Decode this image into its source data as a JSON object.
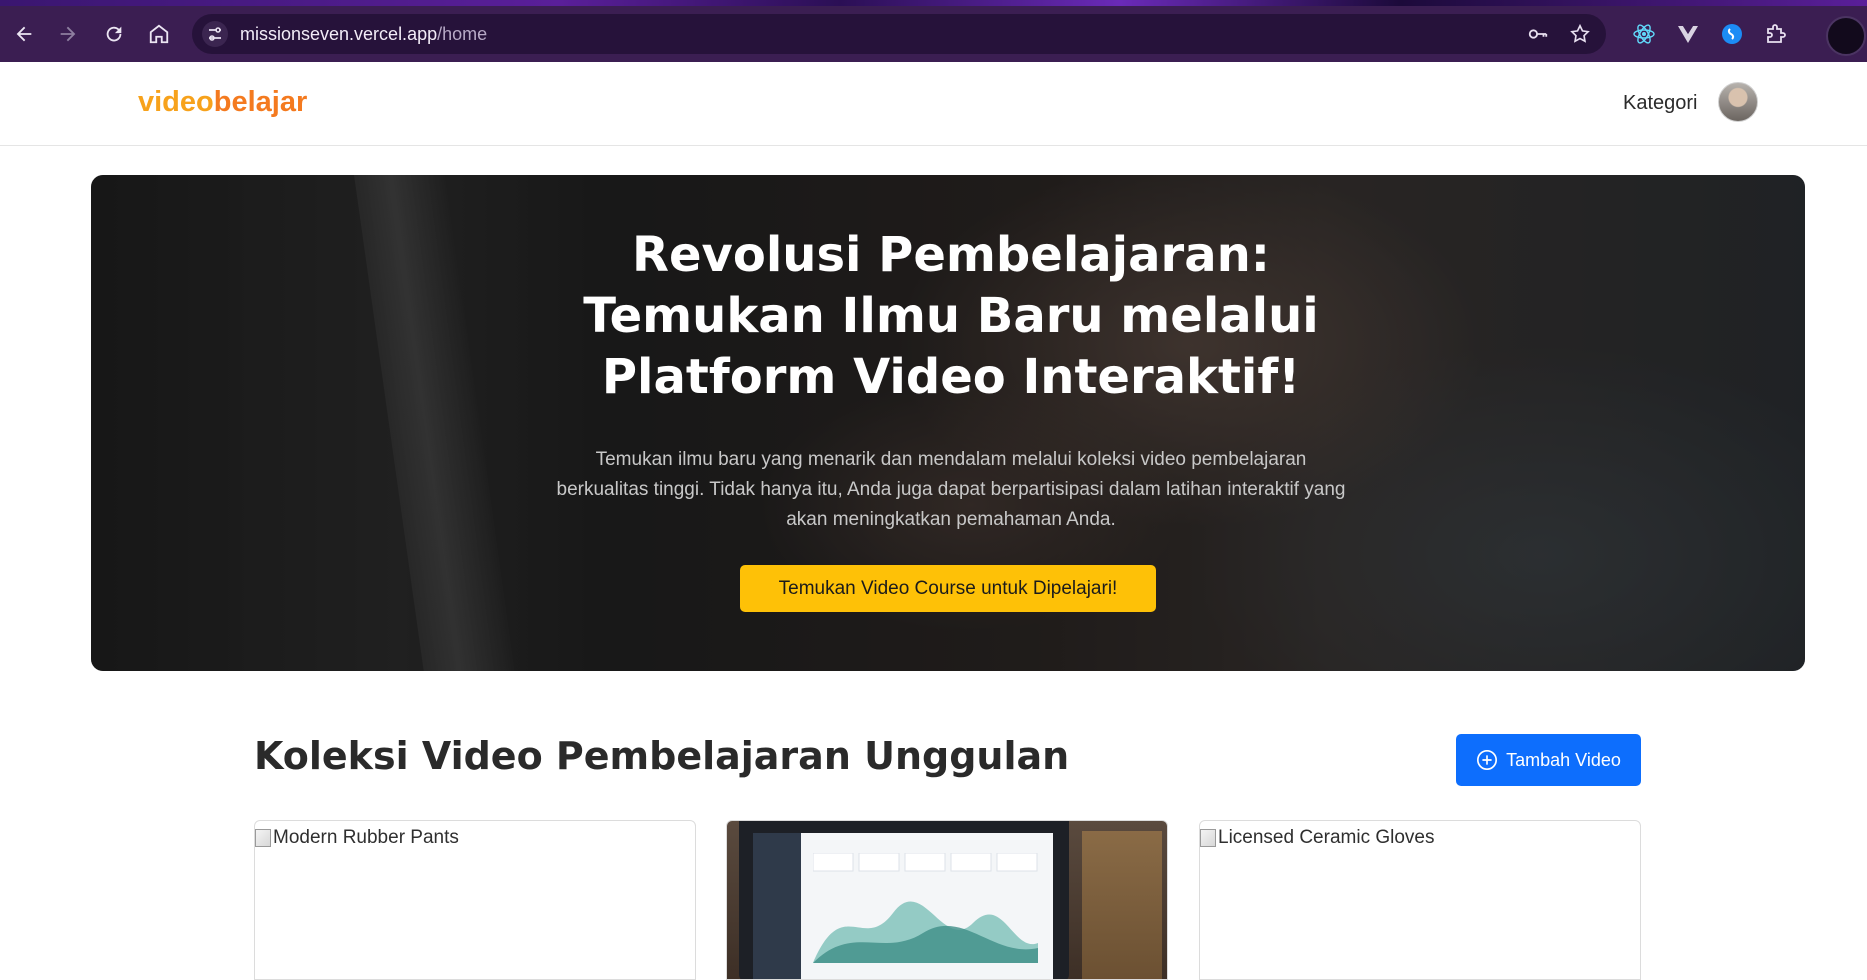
{
  "browser": {
    "url_host": "missionseven.vercel.app",
    "url_path": "/home"
  },
  "header": {
    "logo_part1": "video",
    "logo_part2": "belajar",
    "nav_kategori": "Kategori"
  },
  "hero": {
    "title": "Revolusi Pembelajaran: Temukan Ilmu Baru melalui Platform Video Interaktif!",
    "subtitle": "Temukan ilmu baru yang menarik dan mendalam melalui koleksi video pembelajaran berkualitas tinggi. Tidak hanya itu, Anda juga dapat berpartisipasi dalam latihan interaktif yang akan meningkatkan pemahaman Anda.",
    "cta_label": "Temukan Video Course untuk Dipelajari!"
  },
  "section": {
    "title": "Koleksi Video Pembelajaran Unggulan",
    "add_button_label": "Tambah Video"
  },
  "cards": [
    {
      "alt": "Modern Rubber Pants"
    },
    {
      "alt": ""
    },
    {
      "alt": "Licensed Ceramic Gloves"
    }
  ],
  "colors": {
    "logo_video": "#f7a21b",
    "logo_belajar": "#f47a1f",
    "cta_yellow": "#fec107",
    "primary_blue": "#0d6efd",
    "chrome_bg": "#3b1e52"
  }
}
